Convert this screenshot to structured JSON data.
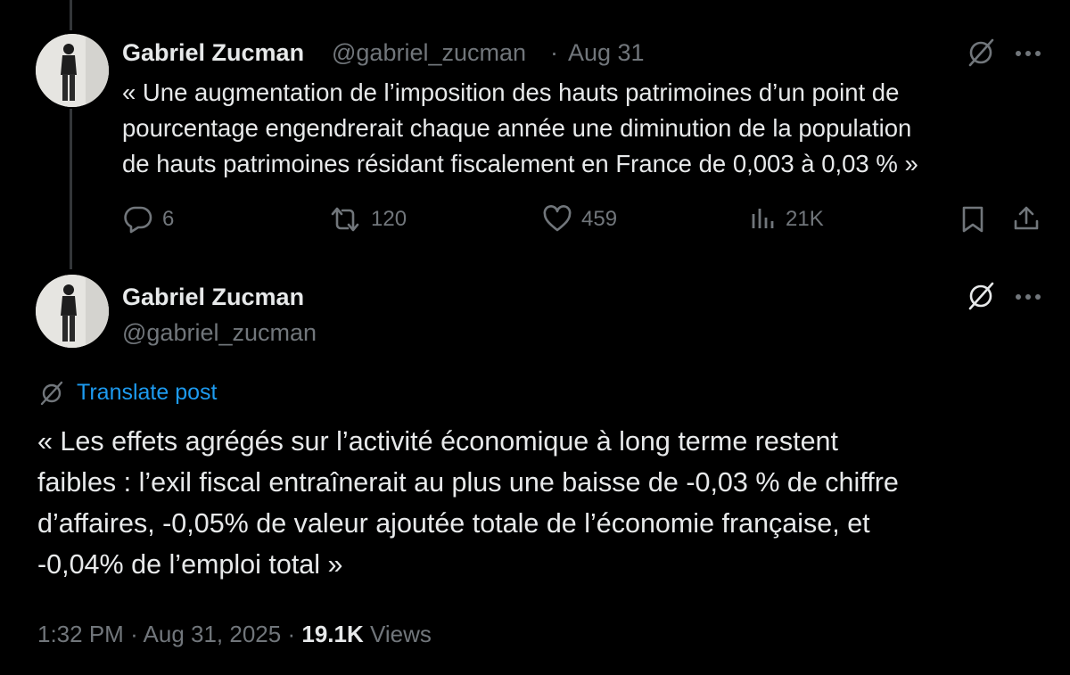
{
  "colors": {
    "background": "#000000",
    "text": "#e7e9ea",
    "muted": "#71767b",
    "link": "#1d9bf0",
    "thread_line": "#333639"
  },
  "post1": {
    "author_name": "Gabriel Zucman",
    "handle": "@gabriel_zucman",
    "separator": "·",
    "date": "Aug 31",
    "text_lines": [
      "« Une augmentation de l’imposition des hauts patrimoines d’un point de",
      "pourcentage engendrerait chaque année une diminution de la population",
      "de hauts patrimoines résidant fiscalement en France de 0,003 à 0,03 % »"
    ],
    "actions": {
      "replies": "6",
      "reposts": "120",
      "likes": "459",
      "views": "21K"
    },
    "icons": [
      "grok-icon",
      "more-icon",
      "reply-icon",
      "repost-icon",
      "like-icon",
      "views-icon",
      "bookmark-icon",
      "share-icon"
    ]
  },
  "post2": {
    "author_name": "Gabriel Zucman",
    "handle": "@gabriel_zucman",
    "translate_label": "Translate post",
    "text_lines": [
      "« Les effets agrégés sur l’activité économique à long terme restent",
      "faibles : l’exil fiscal entraînerait au plus une baisse de -0,03 % de chiffre",
      "d’affaires, -0,05% de valeur ajoutée totale de l’économie française, et",
      "-0,04% de l’emploi total »"
    ],
    "footer": {
      "time": "1:32 PM",
      "separator": "·",
      "date": "Aug 31, 2025",
      "separator2": "·",
      "views_count": "19.1K",
      "views_label": "Views"
    },
    "icons": [
      "grok-icon",
      "more-icon",
      "globe-icon"
    ]
  }
}
